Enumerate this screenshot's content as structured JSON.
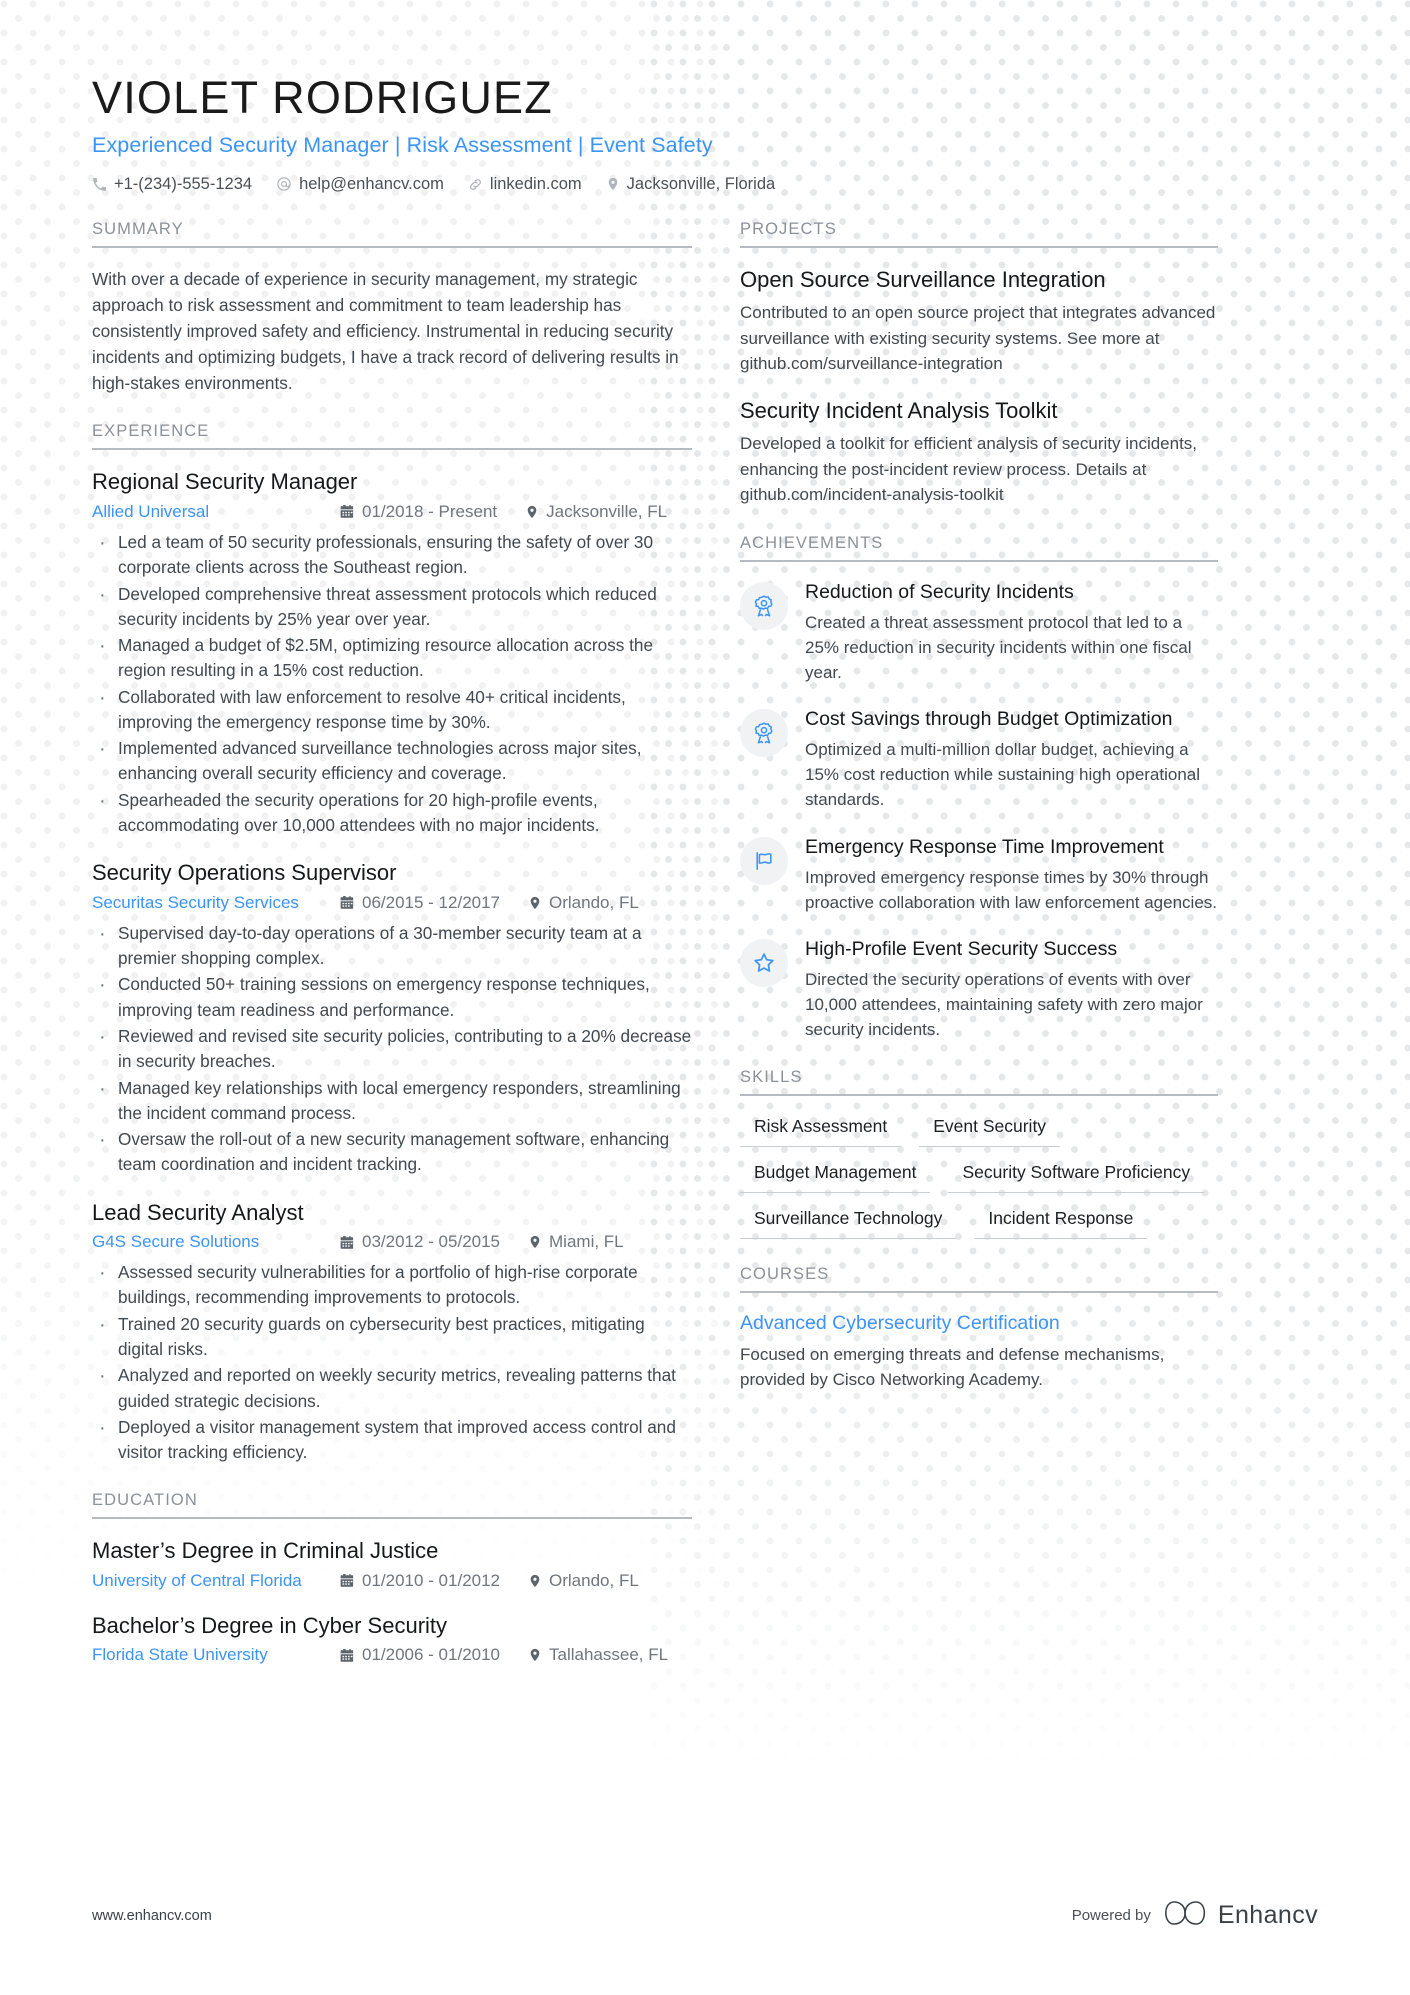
{
  "theme": {
    "accent": "#3b94f7",
    "text": "#414950",
    "heading": "#8a9199",
    "rule": "#b6bbc1"
  },
  "header": {
    "name": "VIOLET RODRIGUEZ",
    "headline": "Experienced Security Manager | Risk Assessment | Event Safety",
    "contact": [
      {
        "icon": "phone-icon",
        "text": "+1-(234)-555-1234"
      },
      {
        "icon": "email-icon",
        "text": "help@enhancv.com"
      },
      {
        "icon": "link-icon",
        "text": "linkedin.com"
      },
      {
        "icon": "location-icon",
        "text": "Jacksonville, Florida"
      }
    ]
  },
  "summary": {
    "title": "SUMMARY",
    "text": "With over a decade of experience in security management, my strategic approach to risk assessment and commitment to team leadership has consistently improved safety and efficiency. Instrumental in reducing security incidents and optimizing budgets, I have a track record of delivering results in high-stakes environments."
  },
  "experience": {
    "title": "EXPERIENCE",
    "items": [
      {
        "role": "Regional Security Manager",
        "org": "Allied Universal",
        "dates": "01/2018 - Present",
        "location": "Jacksonville, FL",
        "bullets": [
          "Led a team of 50 security professionals, ensuring the safety of over 30 corporate clients across the Southeast region.",
          "Developed comprehensive threat assessment protocols which reduced security incidents by 25% year over year.",
          "Managed a budget of $2.5M, optimizing resource allocation across the region resulting in a 15% cost reduction.",
          "Collaborated with law enforcement to resolve 40+ critical incidents, improving the emergency response time by 30%.",
          "Implemented advanced surveillance technologies across major sites, enhancing overall security efficiency and coverage.",
          "Spearheaded the security operations for 20 high-profile events, accommodating over 10,000 attendees with no major incidents."
        ]
      },
      {
        "role": "Security Operations Supervisor",
        "org": "Securitas Security Services",
        "dates": "06/2015 - 12/2017",
        "location": "Orlando, FL",
        "bullets": [
          "Supervised day-to-day operations of a 30-member security team at a premier shopping complex.",
          "Conducted 50+ training sessions on emergency response techniques, improving team readiness and performance.",
          "Reviewed and revised site security policies, contributing to a 20% decrease in security breaches.",
          "Managed key relationships with local emergency responders, streamlining the incident command process.",
          "Oversaw the roll-out of a new security management software, enhancing team coordination and incident tracking."
        ]
      },
      {
        "role": "Lead Security Analyst",
        "org": "G4S Secure Solutions",
        "dates": "03/2012 - 05/2015",
        "location": "Miami, FL",
        "bullets": [
          "Assessed security vulnerabilities for a portfolio of high-rise corporate buildings, recommending improvements to protocols.",
          "Trained 20 security guards on cybersecurity best practices, mitigating digital risks.",
          "Analyzed and reported on weekly security metrics, revealing patterns that guided strategic decisions.",
          "Deployed a visitor management system that improved access control and visitor tracking efficiency."
        ]
      }
    ]
  },
  "education": {
    "title": "EDUCATION",
    "items": [
      {
        "degree": "Master’s Degree in Criminal Justice",
        "org": "University of Central Florida",
        "dates": "01/2010 - 01/2012",
        "location": "Orlando, FL"
      },
      {
        "degree": "Bachelor’s Degree in Cyber Security",
        "org": "Florida State University",
        "dates": "01/2006 - 01/2010",
        "location": "Tallahassee, FL"
      }
    ]
  },
  "projects": {
    "title": "PROJECTS",
    "items": [
      {
        "name": "Open Source Surveillance Integration",
        "description": "Contributed to an open source project that integrates advanced surveillance with existing security systems. See more at github.com/surveillance-integration"
      },
      {
        "name": "Security Incident Analysis Toolkit",
        "description": "Developed a toolkit for efficient analysis of security incidents, enhancing the post-incident review process. Details at github.com/incident-analysis-toolkit"
      }
    ]
  },
  "achievements": {
    "title": "ACHIEVEMENTS",
    "items": [
      {
        "icon": "award-ribbon-icon",
        "name": "Reduction of Security Incidents",
        "description": "Created a threat assessment protocol that led to a 25% reduction in security incidents within one fiscal year."
      },
      {
        "icon": "award-ribbon-icon",
        "name": "Cost Savings through Budget Optimization",
        "description": "Optimized a multi-million dollar budget, achieving a 15% cost reduction while sustaining high operational standards."
      },
      {
        "icon": "flag-icon",
        "name": "Emergency Response Time Improvement",
        "description": "Improved emergency response times by 30% through proactive collaboration with law enforcement agencies."
      },
      {
        "icon": "star-icon",
        "name": "High-Profile Event Security Success",
        "description": "Directed the security operations of events with over 10,000 attendees, maintaining safety with zero major security incidents."
      }
    ]
  },
  "skills": {
    "title": "SKILLS",
    "items": [
      "Risk Assessment",
      "Event Security",
      "Budget Management",
      "Security Software Proficiency",
      "Surveillance Technology",
      "Incident Response"
    ]
  },
  "courses": {
    "title": "COURSES",
    "items": [
      {
        "name": "Advanced Cybersecurity Certification",
        "description": "Focused on emerging threats and defense mechanisms, provided by Cisco Networking Academy."
      }
    ]
  },
  "footer": {
    "url": "www.enhancv.com",
    "powered_by": "Powered by",
    "brand": "Enhancv"
  }
}
